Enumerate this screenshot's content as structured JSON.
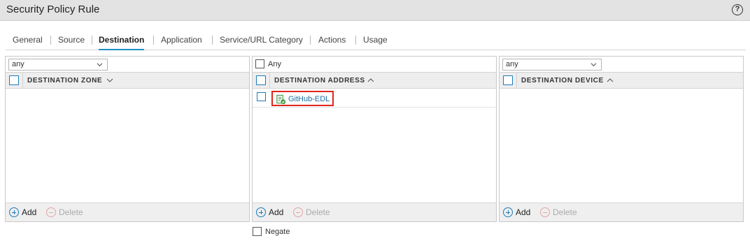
{
  "window": {
    "title": "Security Policy Rule"
  },
  "tabs": [
    {
      "label": "General"
    },
    {
      "label": "Source"
    },
    {
      "label": "Destination"
    },
    {
      "label": "Application"
    },
    {
      "label": "Service/URL Category"
    },
    {
      "label": "Actions"
    },
    {
      "label": "Usage"
    }
  ],
  "active_tab": "Destination",
  "zone_panel": {
    "select_value": "any",
    "column_header": "DESTINATION ZONE",
    "add_label": "Add",
    "delete_label": "Delete"
  },
  "address_panel": {
    "any_label": "Any",
    "column_header": "DESTINATION ADDRESS",
    "rows": [
      {
        "name": "GitHub-EDL",
        "icon": "edl-object-icon"
      }
    ],
    "add_label": "Add",
    "delete_label": "Delete"
  },
  "device_panel": {
    "select_value": "any",
    "column_header": "DESTINATION DEVICE",
    "add_label": "Add",
    "delete_label": "Delete"
  },
  "negate_label": "Negate",
  "colors": {
    "accent": "#1a8fc9",
    "highlight": "#e0261d",
    "link": "#1a6ea8"
  }
}
